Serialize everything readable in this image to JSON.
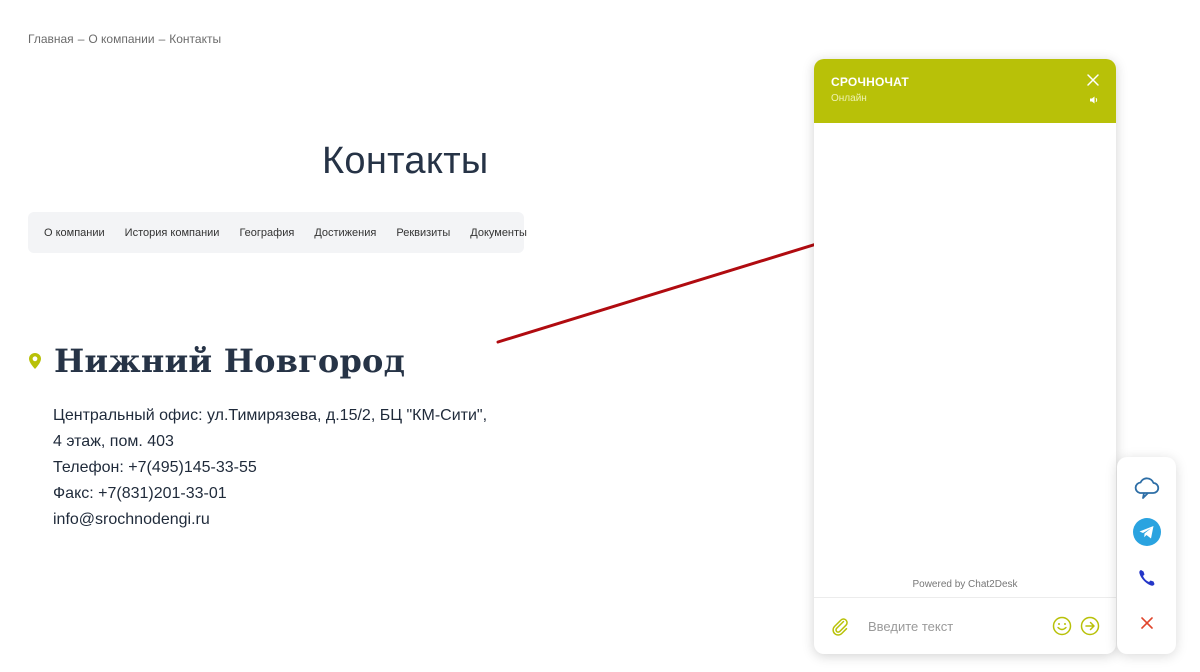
{
  "breadcrumb": {
    "items": [
      "Главная",
      "О компании",
      "Контакты"
    ],
    "separator": "–"
  },
  "page": {
    "title": "Контакты"
  },
  "subnav": {
    "items": [
      "О компании",
      "История компании",
      "География",
      "Достижения",
      "Реквизиты",
      "Документы"
    ]
  },
  "office": {
    "city": "Нижний Новгород",
    "lines": [
      "Центральный офис: ул.Тимирязева, д.15/2, БЦ \"КМ-Сити\",",
      "4 этаж, пом. 403",
      "Телефон: +7(495)145-33-55",
      "Факс: +7(831)201-33-01",
      "info@srochnodengi.ru"
    ]
  },
  "chat": {
    "title": "СРОЧНОЧАТ",
    "status": "Онлайн",
    "powered": "Powered by Chat2Desk",
    "input_placeholder": "Введите текст",
    "header_color": "#b8c108"
  },
  "side_widget": {
    "icons": [
      "cloud-chat-icon",
      "telegram-icon",
      "phone-icon",
      "close-icon"
    ]
  },
  "colors": {
    "accent": "#b8c108",
    "arrow": "#b00b10",
    "heading": "#263346"
  }
}
